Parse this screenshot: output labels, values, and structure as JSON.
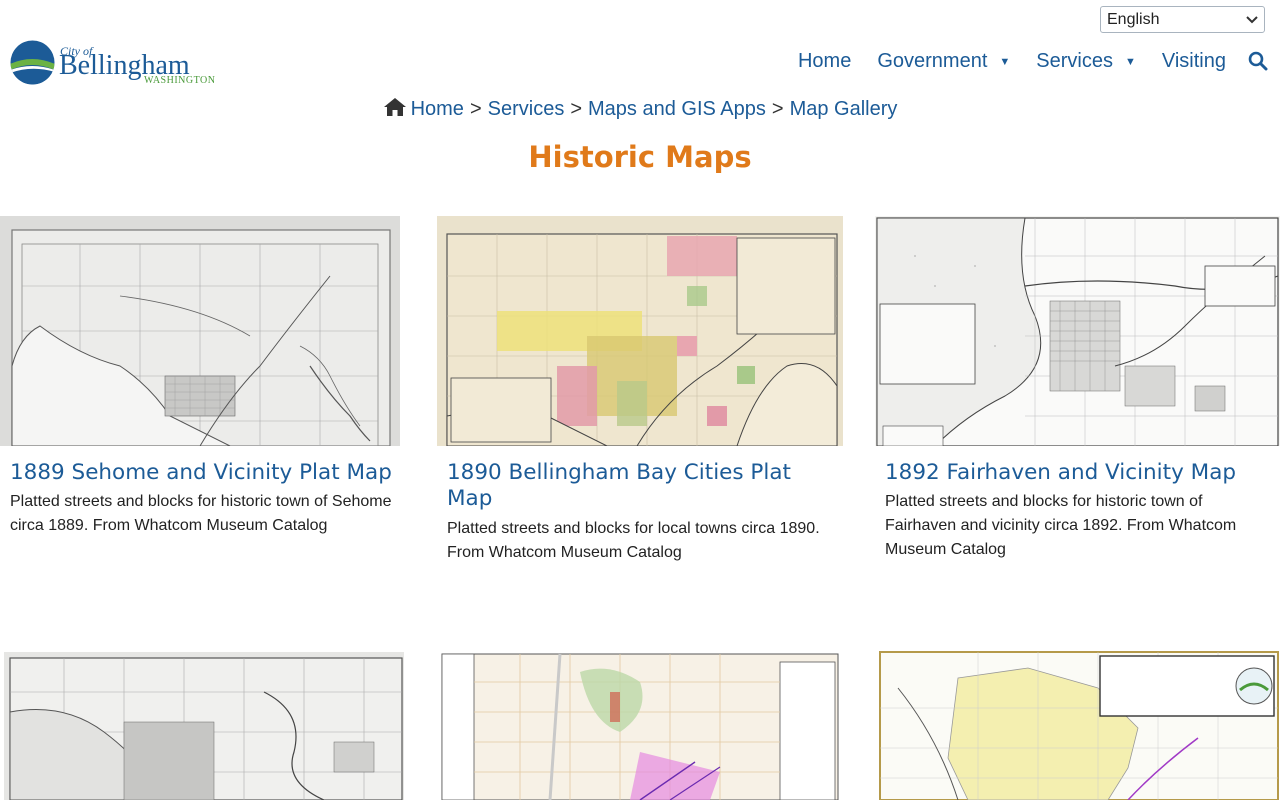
{
  "language": {
    "selected": "English"
  },
  "logo": {
    "city_of": "City of",
    "name": "Bellingham",
    "state": "WASHINGTON"
  },
  "nav": {
    "items": [
      {
        "label": "Home",
        "has_dropdown": false
      },
      {
        "label": "Government",
        "has_dropdown": true
      },
      {
        "label": "Services",
        "has_dropdown": true
      },
      {
        "label": "Visiting",
        "has_dropdown": false
      }
    ]
  },
  "breadcrumb": {
    "items": [
      "Home",
      "Services",
      "Maps and GIS Apps",
      "Map Gallery"
    ],
    "separator": ">"
  },
  "page": {
    "title": "Historic Maps"
  },
  "cards": [
    {
      "title": "1889 Sehome and Vicinity Plat Map",
      "description": "Platted streets and blocks for historic town of Sehome circa 1889. From Whatcom Museum Catalog"
    },
    {
      "title": "1890 Bellingham Bay Cities Plat Map",
      "description": "Platted streets and blocks for local towns circa 1890. From Whatcom Museum Catalog"
    },
    {
      "title": "1892 Fairhaven and Vicinity Map",
      "description": "Platted streets and blocks for historic town of Fairhaven and vicinity circa 1892. From Whatcom Museum Catalog"
    }
  ],
  "colors": {
    "brand_blue": "#1c5b97",
    "title_orange": "#e07a1a",
    "logo_green": "#4a9a3a"
  }
}
